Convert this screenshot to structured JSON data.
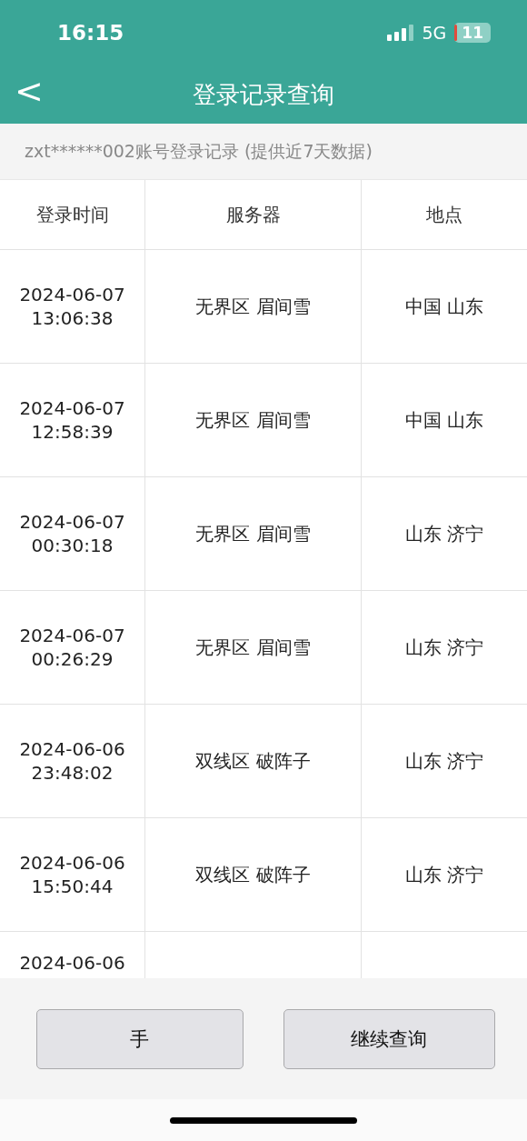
{
  "status_bar": {
    "time": "16:15",
    "network": "5G",
    "battery": "11"
  },
  "header": {
    "back": "<",
    "title": "登录记录查询"
  },
  "subtitle": "zxt******002账号登录记录 (提供近7天数据)",
  "table": {
    "columns": [
      "登录时间",
      "服务器",
      "地点"
    ],
    "rows": [
      {
        "time": [
          "2024-06-07",
          "13:06:38"
        ],
        "server": "无界区 眉间雪",
        "location": "中国 山东"
      },
      {
        "time": [
          "2024-06-07",
          "12:58:39"
        ],
        "server": "无界区 眉间雪",
        "location": "中国 山东"
      },
      {
        "time": [
          "2024-06-07",
          "00:30:18"
        ],
        "server": "无界区 眉间雪",
        "location": "山东 济宁"
      },
      {
        "time": [
          "2024-06-07",
          "00:26:29"
        ],
        "server": "无界区 眉间雪",
        "location": "山东 济宁"
      },
      {
        "time": [
          "2024-06-06",
          "23:48:02"
        ],
        "server": "双线区 破阵子",
        "location": "山东 济宁"
      },
      {
        "time": [
          "2024-06-06",
          "15:50:44"
        ],
        "server": "双线区 破阵子",
        "location": "山东 济宁"
      }
    ],
    "partial_row": {
      "time": "2024-06-06"
    }
  },
  "buttons": [
    "手",
    "继续查询"
  ]
}
